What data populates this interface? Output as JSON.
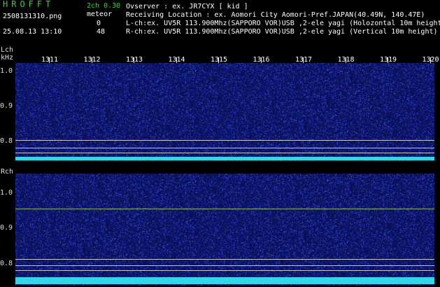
{
  "header": {
    "brand": "HROFFT",
    "version": "2ch 0.30",
    "filename": "2508131310.png",
    "meteor_label": "meteor",
    "datetime": "25.08.13 13:10",
    "meteor_count_l": "0",
    "meteor_count_r": "48",
    "observer": "Ovserver                 : ex. JR7CYX [ kid ]",
    "location": "Receiving Location : ex. Aomori City Aomori-Pref.JAPAN(40.49N, 140.47E)",
    "lch_info": "L-ch:ex. UV5R 113.900Mhz(SAPPORO VOR)USB ,2-ele yagi (Holozontal 10m height)",
    "rch_info": "R-ch:ex. UV5R 113.900Mhz(SAPPORO VOR)USB ,2-ele yagi (Vertical 10m height)"
  },
  "lch": {
    "label": "Lch",
    "unit": "kHz",
    "yticks": [
      "1.0",
      "0.9",
      "0.8"
    ]
  },
  "rch": {
    "label": "Rch",
    "yticks": [
      "1.0",
      "0.9",
      "0.8"
    ]
  },
  "time_ticks": [
    "1311",
    "1312",
    "1313",
    "1314",
    "1315",
    "1316",
    "1317",
    "1318",
    "1319",
    "1320"
  ],
  "colors": {
    "background": "#0a0f55",
    "signal": "#e6e632",
    "baseline": "#2ed8e6",
    "brand": "#36d236"
  }
}
